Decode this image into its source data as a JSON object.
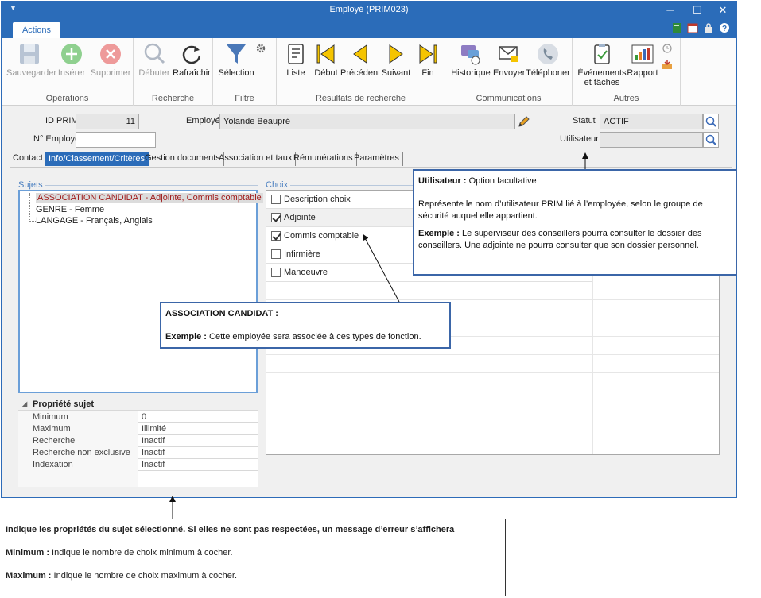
{
  "window": {
    "title": "Employé (PRIM023)",
    "controls": [
      "─",
      "☐",
      "✕"
    ]
  },
  "ribbon": {
    "tab_label": "Actions",
    "groups": [
      {
        "label": "Opérations",
        "buttons": [
          "Sauvegarder",
          "Insérer",
          "Supprimer"
        ]
      },
      {
        "label": "Recherche",
        "buttons": [
          "Débuter",
          "Rafraîchir"
        ]
      },
      {
        "label": "Filtre",
        "buttons": [
          "Sélection"
        ]
      },
      {
        "label": "Résultats de recherche",
        "buttons": [
          "Liste",
          "Début",
          "Précédent",
          "Suivant",
          "Fin"
        ]
      },
      {
        "label": "Communications",
        "buttons": [
          "Historique",
          "Envoyer",
          "Téléphoner"
        ]
      },
      {
        "label": "Autres",
        "buttons": [
          "Événements et tâches",
          "Rapport"
        ]
      }
    ],
    "colors": {
      "ribbon_blue": "#2b6cb9",
      "green_add": "#7fc87f",
      "red_delete": "#e89090",
      "yellow_nav": "#f5c400"
    }
  },
  "form": {
    "id_prim_label": "ID PRIM",
    "id_prim_value": "11",
    "employe_label": "Employé",
    "employe_value": "Yolande Beaupré",
    "no_employe_label": "N° Employé",
    "no_employe_value": "",
    "statut_label": "Statut",
    "statut_value": "ACTIF",
    "utilisateur_label": "Utilisateur",
    "utilisateur_value": ""
  },
  "tabs": [
    {
      "label": "Contact",
      "active": false
    },
    {
      "label": "Info/Classement/Critères",
      "active": true
    },
    {
      "label": "Gestion documents",
      "active": false
    },
    {
      "label": "Association et taux",
      "active": false
    },
    {
      "label": "Rémunérations",
      "active": false
    },
    {
      "label": "Paramètres",
      "active": false
    }
  ],
  "subjects": {
    "legend": "Sujets",
    "items": [
      {
        "label": "ASSOCIATION CANDIDAT - Adjointe, Commis comptable",
        "selected": true
      },
      {
        "label": "GENRE - Femme",
        "selected": false
      },
      {
        "label": "LANGAGE - Français, Anglais",
        "selected": false
      }
    ]
  },
  "properties": {
    "header": "Propriété sujet",
    "rows": [
      {
        "key": "Minimum",
        "value": "0"
      },
      {
        "key": "Maximum",
        "value": "Illimité"
      },
      {
        "key": "Recherche",
        "value": "Inactif"
      },
      {
        "key": "Recherche non exclusive",
        "value": "Inactif"
      },
      {
        "key": "Indexation",
        "value": "Inactif"
      }
    ]
  },
  "choices": {
    "legend": "Choix",
    "items": [
      {
        "label": "Description choix",
        "checked": false
      },
      {
        "label": "Adjointe",
        "checked": true
      },
      {
        "label": "Commis comptable",
        "checked": true
      },
      {
        "label": "Infirmière",
        "checked": false
      },
      {
        "label": "Manoeuvre",
        "checked": false
      }
    ]
  },
  "callouts": {
    "utilisateur": {
      "title": "Utilisateur :",
      "title_rest": " Option facultative",
      "body": "Représente le nom d’utilisateur PRIM lié à l’employée, selon le groupe de sécurité auquel elle appartient.",
      "example_label": "Exemple :",
      "example_text": " Le superviseur des conseillers pourra consulter le dossier des conseillers. Une adjointe ne pourra consulter que son dossier personnel."
    },
    "association": {
      "title": "ASSOCIATION CANDIDAT :",
      "example_label": "Exemple :",
      "example_text": " Cette employée sera associée à ces types de fonction."
    },
    "proprietes": {
      "headline": "Indique les propriétés du sujet sélectionné. Si elles ne sont pas respectées, un message d’erreur s’affichera",
      "minimum_label": "Minimum :",
      "minimum_text": " Indique le nombre de choix minimum à cocher.",
      "maximum_label": "Maximum :",
      "maximum_text": " Indique le nombre de choix maximum à cocher."
    }
  }
}
